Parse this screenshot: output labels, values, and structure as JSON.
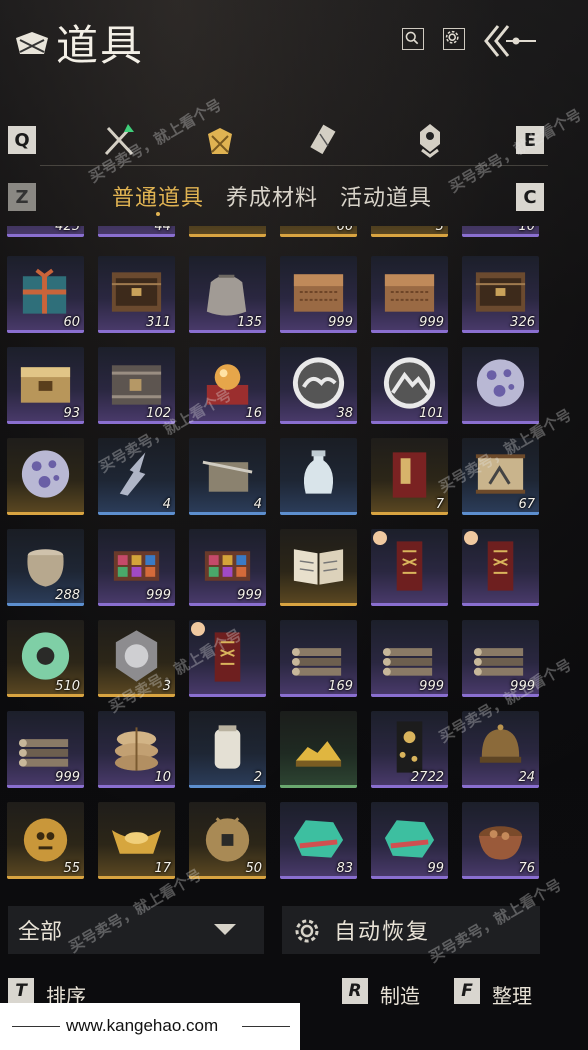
{
  "header": {
    "title": "道具",
    "icons": [
      "search-icon",
      "gear-icon",
      "back-arrow-icon"
    ]
  },
  "tabs": {
    "left_key": "Q",
    "right_key": "E",
    "icons": [
      "weapon-tab-icon",
      "pouch-tab-icon",
      "scroll-tab-icon",
      "token-tab-icon"
    ],
    "active_index": 1
  },
  "subtabs": {
    "left_key": "Z",
    "right_key": "C",
    "items": [
      "普通道具",
      "养成材料",
      "活动道具"
    ],
    "active_index": 0
  },
  "partial_row_counts": [
    "425",
    "44",
    "",
    "66",
    "3",
    "10"
  ],
  "grid": [
    {
      "icon": "wrapped-gift",
      "count": "60",
      "quality": "purple"
    },
    {
      "icon": "wooden-chest",
      "count": "311",
      "quality": "purple"
    },
    {
      "icon": "cloth-sack",
      "count": "135",
      "quality": "purple"
    },
    {
      "icon": "ornate-chest",
      "count": "999",
      "quality": "purple"
    },
    {
      "icon": "ornate-chest",
      "count": "999",
      "quality": "purple"
    },
    {
      "icon": "wooden-chest",
      "count": "326",
      "quality": "purple"
    },
    {
      "icon": "gold-chest",
      "count": "93",
      "quality": "purple"
    },
    {
      "icon": "iron-chest",
      "count": "102",
      "quality": "purple"
    },
    {
      "icon": "orb-pedestal",
      "count": "16",
      "quality": "purple"
    },
    {
      "icon": "cloud-emblem",
      "count": "38",
      "quality": "purple"
    },
    {
      "icon": "mountain-emblem",
      "count": "101",
      "quality": "purple"
    },
    {
      "icon": "spirit-orb",
      "count": "",
      "quality": "purple"
    },
    {
      "icon": "spirit-orb",
      "count": "",
      "quality": "gold"
    },
    {
      "icon": "lightning-scroll",
      "count": "4",
      "quality": "blue"
    },
    {
      "icon": "sword-paper",
      "count": "4",
      "quality": "blue"
    },
    {
      "icon": "porcelain-vase",
      "count": "",
      "quality": "blue"
    },
    {
      "icon": "red-book",
      "count": "7",
      "quality": "gold"
    },
    {
      "icon": "painted-scroll",
      "count": "67",
      "quality": "blue"
    },
    {
      "icon": "clay-pot",
      "count": "288",
      "quality": "blue"
    },
    {
      "icon": "pigment-box",
      "count": "999",
      "quality": "purple"
    },
    {
      "icon": "pigment-box",
      "count": "999",
      "quality": "purple"
    },
    {
      "icon": "open-book",
      "count": "",
      "quality": "gold"
    },
    {
      "icon": "red-talisman",
      "count": "",
      "quality": "purple",
      "timed": true
    },
    {
      "icon": "red-talisman",
      "count": "",
      "quality": "purple",
      "timed": true
    },
    {
      "icon": "jade-ring",
      "count": "510",
      "quality": "gold"
    },
    {
      "icon": "silver-coin",
      "count": "3",
      "quality": "gold"
    },
    {
      "icon": "red-talisman",
      "count": "",
      "quality": "purple",
      "timed": true
    },
    {
      "icon": "log-pile",
      "count": "169",
      "quality": "purple"
    },
    {
      "icon": "log-pile",
      "count": "999",
      "quality": "purple"
    },
    {
      "icon": "log-pile",
      "count": "999",
      "quality": "purple"
    },
    {
      "icon": "log-pile",
      "count": "999",
      "quality": "purple"
    },
    {
      "icon": "grain-sacks",
      "count": "10",
      "quality": "purple"
    },
    {
      "icon": "white-jar",
      "count": "2",
      "quality": "blue"
    },
    {
      "icon": "gold-pile",
      "count": "",
      "quality": "green"
    },
    {
      "icon": "money-envelope",
      "count": "2722",
      "quality": "purple"
    },
    {
      "icon": "bronze-helmet",
      "count": "24",
      "quality": "purple"
    },
    {
      "icon": "gold-bell",
      "count": "55",
      "quality": "gold"
    },
    {
      "icon": "gold-ingot",
      "count": "17",
      "quality": "gold"
    },
    {
      "icon": "copper-coin",
      "count": "50",
      "quality": "gold"
    },
    {
      "icon": "jade-ore",
      "count": "83",
      "quality": "purple"
    },
    {
      "icon": "jade-ore",
      "count": "99",
      "quality": "purple"
    },
    {
      "icon": "stew-bowl",
      "count": "76",
      "quality": "purple"
    }
  ],
  "footer": {
    "filter_label": "全部",
    "auto_label": "自动恢复",
    "sort_key": "T",
    "sort_label": "排序",
    "craft_key": "R",
    "craft_label": "制造",
    "arrange_key": "F",
    "arrange_label": "整理"
  },
  "watermark": {
    "url": "www.kangehao.com",
    "stamp": "买号卖号，就上看个号",
    "stamp_url": "www.kangehao.com"
  },
  "colors": {
    "accent_gold": "#e0b352",
    "quality_purple": "#8a6fd0",
    "quality_gold": "#d9a441",
    "quality_blue": "#5d8fcf",
    "quality_green": "#6aa86f"
  }
}
